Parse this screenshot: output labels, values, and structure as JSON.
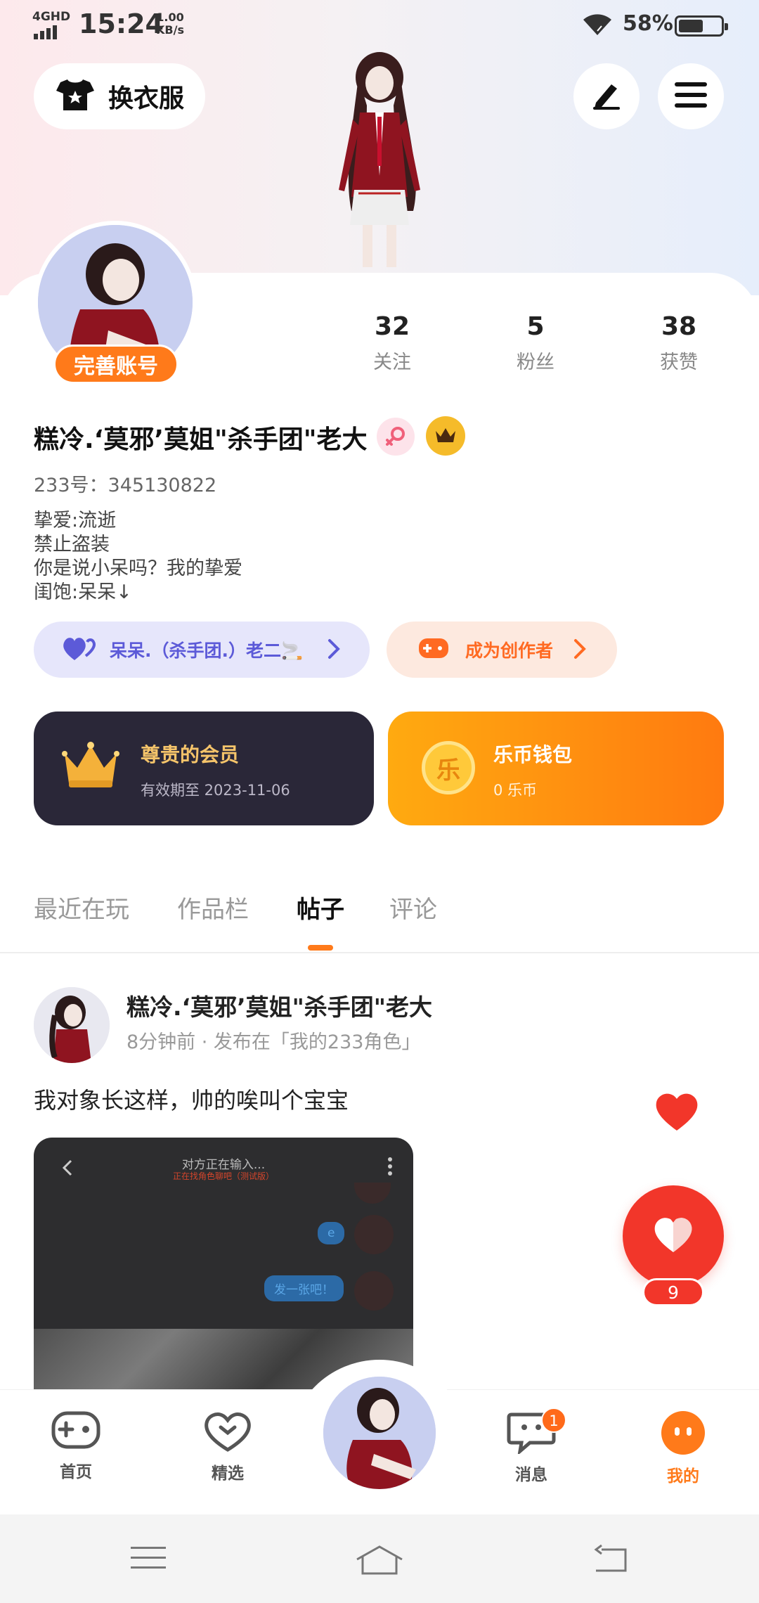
{
  "status_bar": {
    "network": "4GHD",
    "time": "15:24",
    "speed_value": "1.00",
    "speed_unit": "KB/s",
    "battery_percent": "58%"
  },
  "header": {
    "outfit_label": "换衣服",
    "outfit_icon": "tshirt-star-icon",
    "edit_icon": "pencil-icon",
    "menu_icon": "hamburger-menu-icon"
  },
  "profile": {
    "complete_badge": "完善账号",
    "stats": [
      {
        "value": "32",
        "label": "关注"
      },
      {
        "value": "5",
        "label": "粉丝"
      },
      {
        "value": "38",
        "label": "获赞"
      }
    ],
    "username": "糕冷.‘莫邪’莫姐\"杀手团\"老大",
    "uid": "233号：345130822",
    "bio_lines": [
      "挚爱:流逝",
      "禁止盗装",
      "你是说小呆吗？我的挚爱",
      "闺饱:呆呆↓"
    ],
    "relation_label": "呆呆.（杀手团.）老二🚬",
    "creator_label": "成为创作者"
  },
  "cards": {
    "vip_title": "尊贵的会员",
    "vip_sub": "有效期至 2023-11-06",
    "wallet_title": "乐币钱包",
    "wallet_sub": "0 乐币",
    "wallet_coin": "乐"
  },
  "tabs": [
    {
      "label": "最近在玩",
      "active": false
    },
    {
      "label": "作品栏",
      "active": false
    },
    {
      "label": "帖子",
      "active": true
    },
    {
      "label": "评论",
      "active": false
    }
  ],
  "post": {
    "author": "糕冷.‘莫邪’莫姐\"杀手团\"老大",
    "meta": "8分钟前 · 发布在「我的233角色」",
    "text": "我对象长这样，帅的唉叫个宝宝",
    "image_title": "对方正在输入...",
    "image_sub": "正在找角色聊吧（测试版）",
    "bubble_1": "e",
    "bubble_2": "发一张吧！",
    "like_count": "9"
  },
  "bottom_nav": {
    "items": [
      {
        "label": "首页",
        "icon": "gamepad-icon"
      },
      {
        "label": "精选",
        "icon": "heart-chevron-icon"
      },
      {
        "label": "消息",
        "icon": "chat-bubble-icon",
        "badge": "1"
      },
      {
        "label": "我的",
        "icon": "smiley-face-icon",
        "active": true
      }
    ]
  },
  "colors": {
    "accent": "#ff7a1a",
    "like_red": "#f2362a",
    "vip_bg": "#2a2738",
    "vip_gold": "#f5c46a",
    "relation_purple": "#5c5ad8"
  }
}
